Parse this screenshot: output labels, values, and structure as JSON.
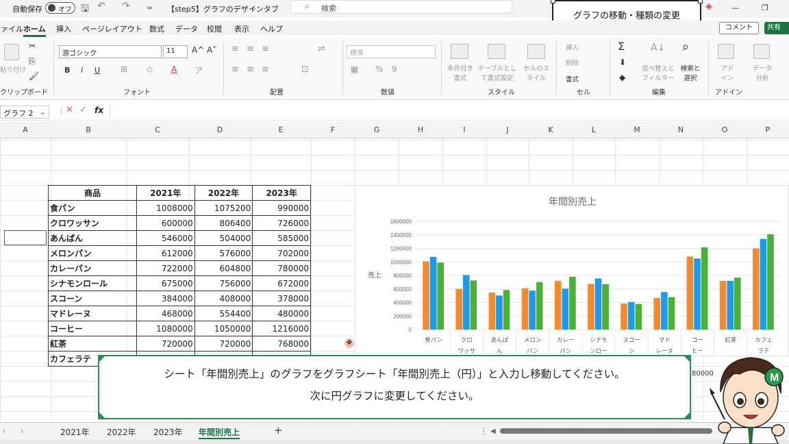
{
  "titlebar": {
    "autosave_label": "自動保存",
    "autosave_state": "オフ",
    "file_name": "【step5】グラフのデザインタブ",
    "search_placeholder": "検索"
  },
  "annotation_title": "グラフの移動・種類の変更",
  "menu": [
    "ファイル",
    "ホーム",
    "挿入",
    "ページレイアウト",
    "数式",
    "データ",
    "校閲",
    "表示",
    "ヘルプ"
  ],
  "menu_active": "ホーム",
  "comment_button": "コメント",
  "share_button": "共有",
  "ribbon": {
    "clipboard_label": "クリップボード",
    "paste_label": "貼り付け",
    "font_group_label": "フォント",
    "font_name": "游ゴシック",
    "font_size": "11",
    "bold": "B",
    "italic": "I",
    "underline": "U",
    "align_label": "配置",
    "number_label": "数値",
    "number_format": "標準",
    "style_label": "スタイル",
    "cond_format": "条件付き書式",
    "table_format": "テーブルとして書式設定",
    "cell_style": "セルのスタイル",
    "cells_label": "セル",
    "insert": "挿入",
    "delete": "削除",
    "format": "書式",
    "edit_label": "編集",
    "sort_filter": "並べ替えとフィルター",
    "find_select": "検索と選択",
    "addin_group": "アドイン",
    "addin": "アドイン",
    "data_analysis": "データ分析"
  },
  "formula": {
    "name_box": "グラフ 2",
    "fx": "fx"
  },
  "columns": [
    "A",
    "B",
    "C",
    "D",
    "E",
    "F",
    "G",
    "H",
    "I",
    "J",
    "K",
    "L",
    "M",
    "N",
    "O",
    "P"
  ],
  "table": {
    "headers": [
      "商品",
      "2021年",
      "2022年",
      "2023年"
    ],
    "rows": [
      {
        "name": "食パン",
        "v": [
          "1008000",
          "1075200",
          "990000"
        ]
      },
      {
        "name": "クロワッサン",
        "v": [
          "600000",
          "806400",
          "726000"
        ]
      },
      {
        "name": "あんぱん",
        "v": [
          "546000",
          "504000",
          "585000"
        ]
      },
      {
        "name": "メロンパン",
        "v": [
          "612000",
          "576000",
          "702000"
        ]
      },
      {
        "name": "カレーパン",
        "v": [
          "722000",
          "604800",
          "780000"
        ]
      },
      {
        "name": "シナモンロール",
        "v": [
          "675000",
          "756000",
          "672000"
        ]
      },
      {
        "name": "スコーン",
        "v": [
          "384000",
          "408000",
          "378000"
        ]
      },
      {
        "name": "マドレーヌ",
        "v": [
          "468000",
          "554400",
          "480000"
        ]
      },
      {
        "name": "コーヒー",
        "v": [
          "1080000",
          "1050000",
          "1216000"
        ]
      },
      {
        "name": "紅茶",
        "v": [
          "720000",
          "720000",
          "768000"
        ]
      },
      {
        "name": "カフェラテ",
        "v": [
          "",
          "",
          ""
        ]
      }
    ]
  },
  "chart_data": {
    "type": "bar",
    "title": "年間別売上",
    "ylabel": "売上",
    "ylim": [
      0,
      1600000
    ],
    "yticks": [
      "1600000",
      "1400000",
      "1200000",
      "1000000",
      "800000",
      "600000",
      "400000",
      "200000",
      "0"
    ],
    "categories": [
      "食パン",
      "クロワッサン",
      "あんぱん",
      "メロンパン",
      "カレーパン",
      "シナモンロール",
      "スコーン",
      "マドレーヌ",
      "コーヒー",
      "紅茶",
      "カフェラテ"
    ],
    "category_labels_visible": [
      "食パン",
      "クロ ワッサ",
      "あんぱ ん",
      "メロン パン",
      "カレー パン",
      "シナモ ンロー",
      "スコー ン",
      "マド レーヌ",
      "コー ヒー",
      "紅茶",
      "カフェ ラテ"
    ],
    "series": [
      {
        "values": [
          1008000,
          600000,
          546000,
          612000,
          722000,
          675000,
          384000,
          468000,
          1080000,
          720000,
          1200000
        ]
      },
      {
        "values": [
          1075200,
          806400,
          504000,
          576000,
          604800,
          756000,
          408000,
          554400,
          1050000,
          720000,
          1340000
        ]
      },
      {
        "values": [
          990000,
          726000,
          585000,
          702000,
          780000,
          672000,
          378000,
          480000,
          1216000,
          768000,
          1410000
        ]
      }
    ],
    "colors": [
      "#f28a30",
      "#1e9be8",
      "#4caf3a"
    ],
    "grid": true
  },
  "caption": {
    "line1": "シート「年間別売上」のグラフをグラフシート「年間別売上（円）」と入力し移動してください。",
    "line2": "次に円グラフに変更してください。"
  },
  "sheet_tabs": [
    "2021年",
    "2022年",
    "2023年",
    "年間別売上"
  ],
  "sheet_active": "年間別売上",
  "add_sheet": "+",
  "partial_cell_text": "80000"
}
